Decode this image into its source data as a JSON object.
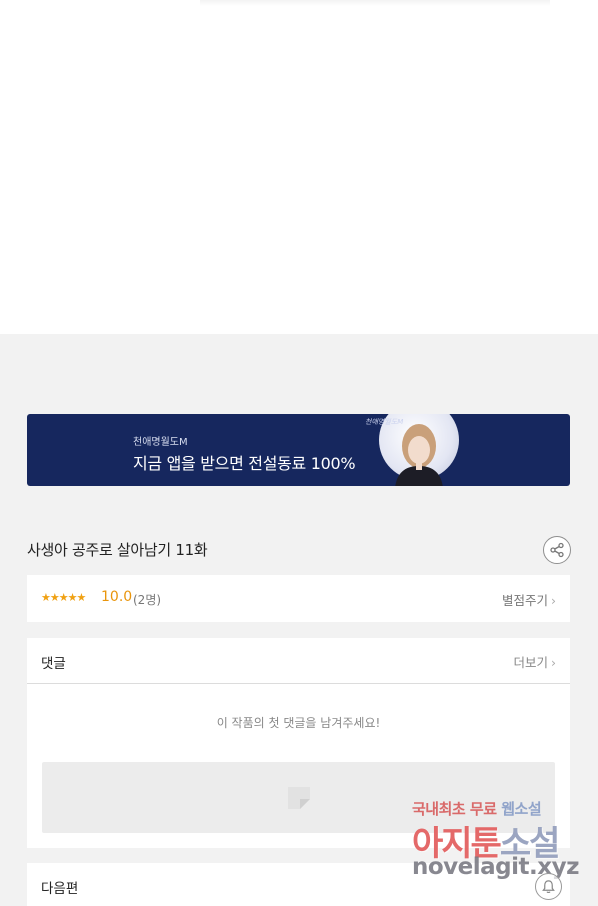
{
  "banner": {
    "subtitle": "천애명월도M",
    "headline": "지금 앱을 받으면 전설동료 100%",
    "logo": "천애명월도M"
  },
  "episode": {
    "title": "사생아 공주로 살아남기 11화"
  },
  "rating": {
    "stars": "★★★★★",
    "score": "10.0",
    "count": "(2명)",
    "action_label": "별점주기",
    "star_color": "#f0a113"
  },
  "comments": {
    "title": "댓글",
    "more_label": "더보기",
    "empty_message": "이 작품의 첫 댓글을 남겨주세요!"
  },
  "next": {
    "title": "다음편"
  },
  "watermark": {
    "line1_a": "국내최초 무료 ",
    "line1_b": "웹소설",
    "line2_a": "아지툰",
    "line2_b": "소설",
    "line3": "novelagit.xyz"
  },
  "colors": {
    "banner_bg": "#16275e",
    "page_bg": "#f2f2f2"
  }
}
